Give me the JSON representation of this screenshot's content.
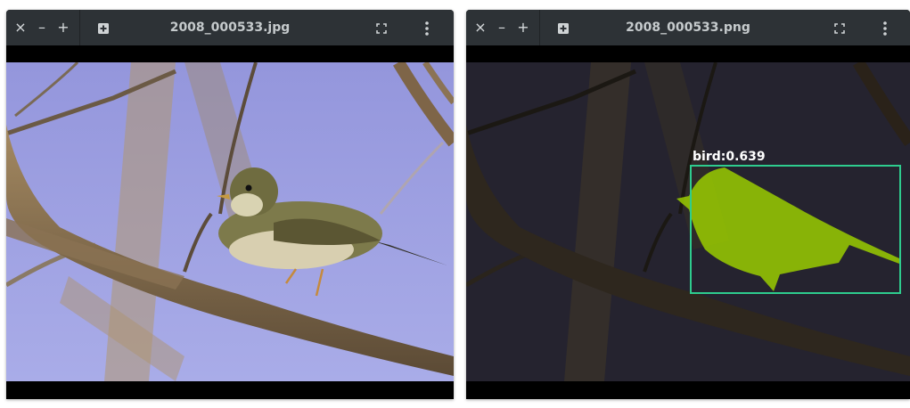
{
  "left_window": {
    "title": "2008_000533.jpg",
    "close_label": "×",
    "minimize_label": "–",
    "zoom_label": "+",
    "icons": [
      "close-icon",
      "minimize-icon",
      "zoom-in-icon",
      "add-image-icon",
      "fullscreen-icon",
      "menu-icon"
    ]
  },
  "right_window": {
    "title": "2008_000533.png",
    "close_label": "×",
    "minimize_label": "–",
    "zoom_label": "+",
    "detection": {
      "label": "bird:0.639",
      "box_color": "#2ecc8e",
      "mask_color": "#9acd00"
    }
  },
  "colors": {
    "titlebar": "#2d3236",
    "sky": "#9c9ee0",
    "dark_sky": "#25232f"
  }
}
